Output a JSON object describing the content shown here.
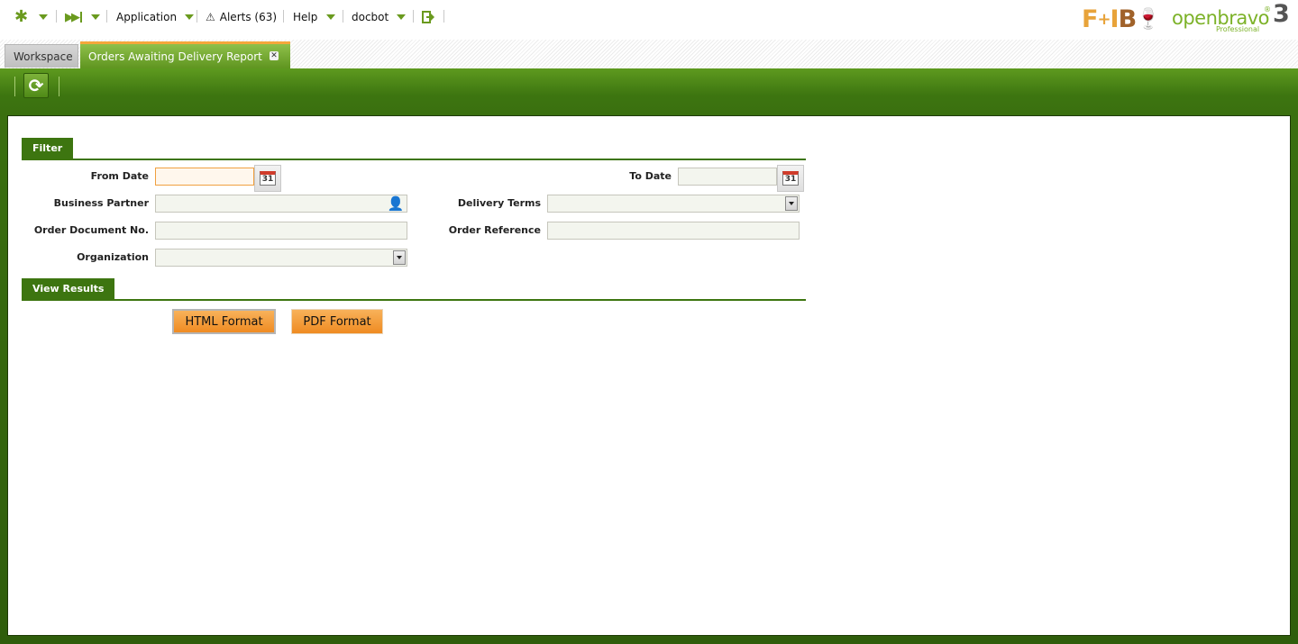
{
  "topnav": {
    "application": "Application",
    "alerts": "Alerts (63)",
    "help": "Help",
    "user": "docbot"
  },
  "brand": {
    "fb_logo_text": "F+IB",
    "ob_wordmark": "openbravo",
    "ob_version": "3",
    "ob_edition": "Professional"
  },
  "tabs": {
    "workspace": "Workspace",
    "report": "Orders Awaiting Delivery Report"
  },
  "filter": {
    "section_title": "Filter",
    "from_date_label": "From Date",
    "from_date_value": "",
    "to_date_label": "To Date",
    "to_date_value": "",
    "business_partner_label": "Business Partner",
    "business_partner_value": "",
    "delivery_terms_label": "Delivery Terms",
    "delivery_terms_value": "",
    "order_doc_label": "Order Document No.",
    "order_doc_value": "",
    "order_ref_label": "Order Reference",
    "order_ref_value": "",
    "organization_label": "Organization",
    "organization_value": ""
  },
  "results": {
    "section_title": "View Results",
    "html_button": "HTML Format",
    "pdf_button": "PDF Format"
  },
  "colors": {
    "brand_green": "#3d7510",
    "accent_orange": "#ef8b22",
    "tab_active_top": "#f5a73b"
  },
  "icons": {
    "calendar_day": "31"
  }
}
